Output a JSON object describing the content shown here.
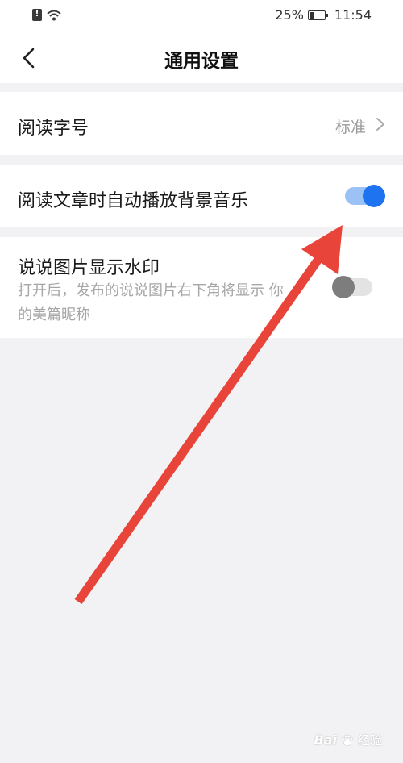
{
  "status_bar": {
    "battery_percent": "25%",
    "time": "11:54",
    "icons": [
      "alert-icon",
      "wifi-icon",
      "battery-icon"
    ]
  },
  "header": {
    "title": "通用设置",
    "back_icon": "chevron-left-icon"
  },
  "settings": {
    "font_size": {
      "label": "阅读字号",
      "value": "标准"
    },
    "auto_music": {
      "label": "阅读文章时自动播放背景音乐",
      "enabled": true
    },
    "watermark": {
      "label": "说说图片显示水印",
      "desc": "打开后，发布的说说图片右下角将显示 你的美篇昵称",
      "enabled": false
    }
  },
  "annotation": {
    "arrow_color": "#e8443a"
  },
  "page_watermark": {
    "brand": "Bai",
    "suffix": "经验"
  },
  "colors": {
    "background": "#f2f2f4",
    "card": "#ffffff",
    "toggle_on_track": "#9cc2f5",
    "toggle_on_knob": "#1e73f0",
    "toggle_off_track": "#e3e3e3",
    "toggle_off_knob": "#7d7d7d"
  }
}
